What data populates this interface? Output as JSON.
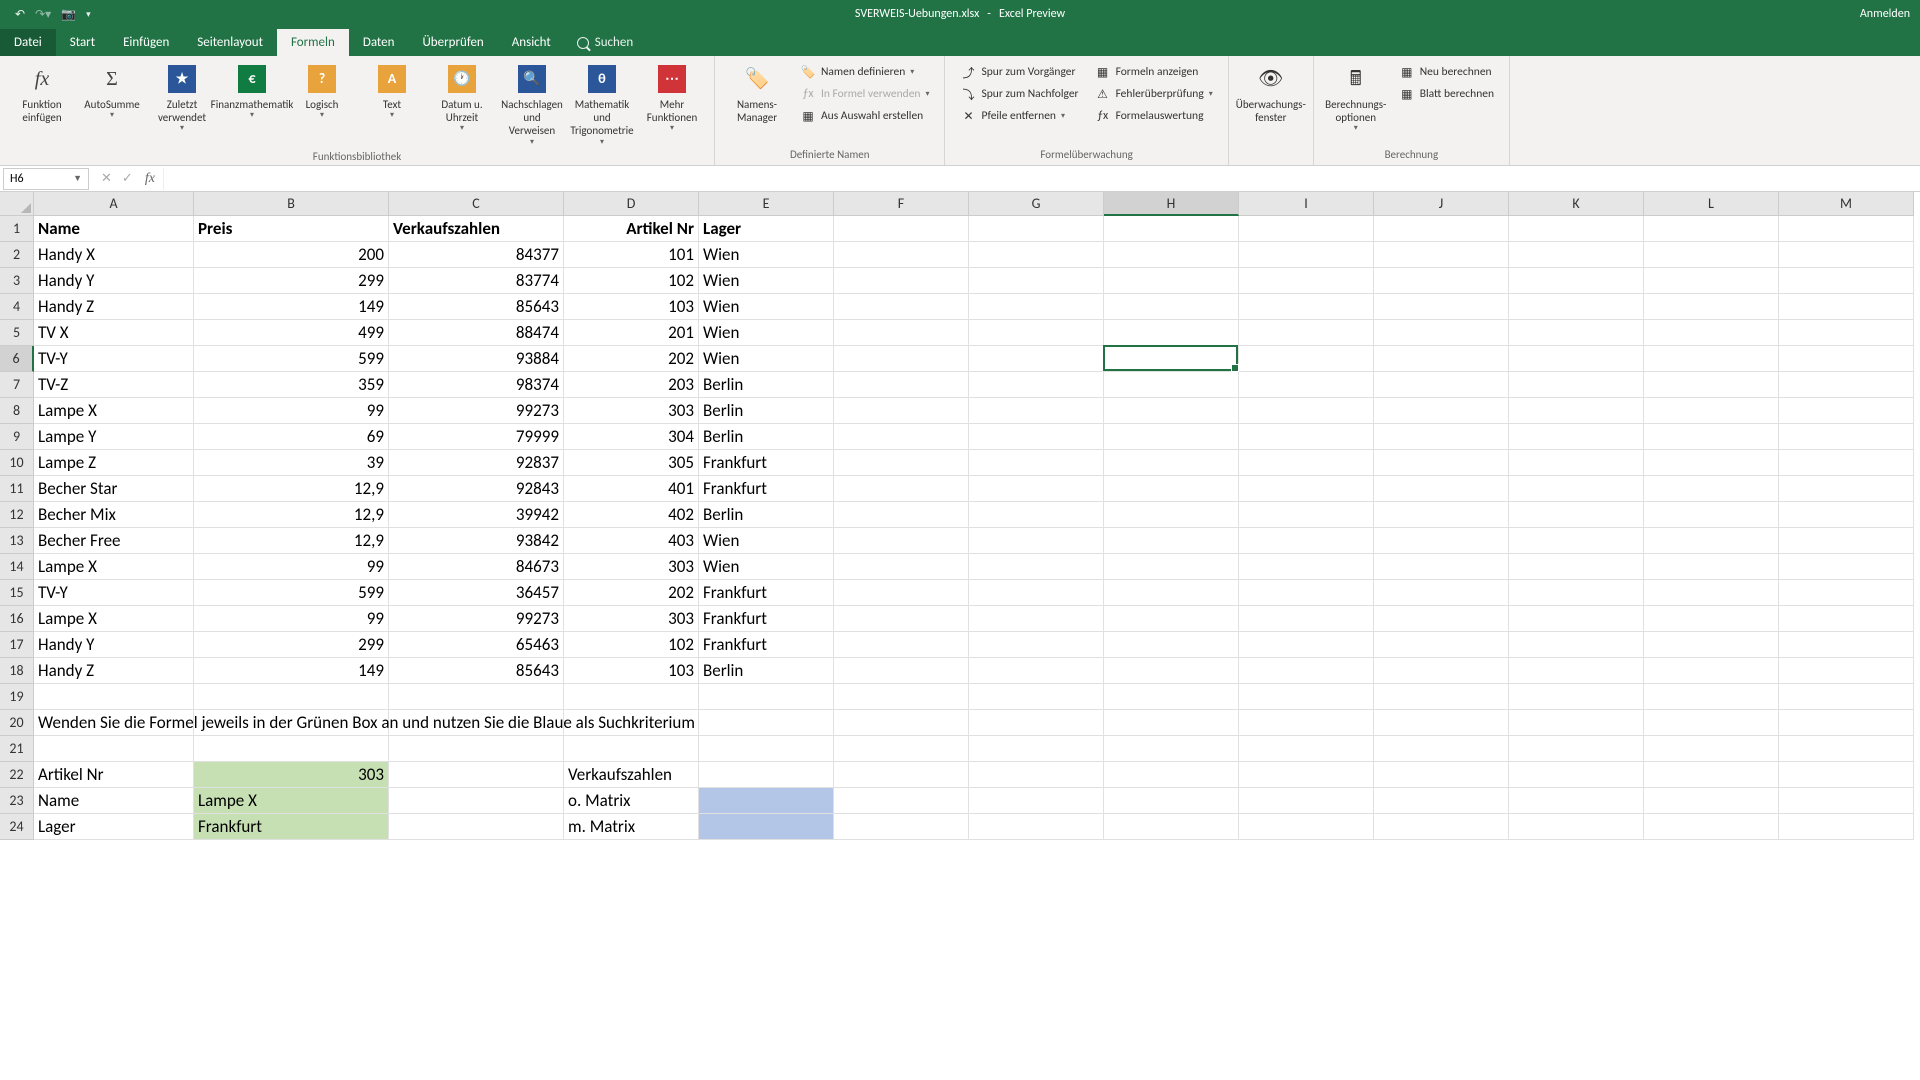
{
  "titlebar": {
    "filename": "SVERWEIS-Uebungen.xlsx",
    "app": "Excel Preview",
    "login": "Anmelden"
  },
  "tabs": {
    "file": "Datei",
    "start": "Start",
    "insert": "Einfügen",
    "layout": "Seitenlayout",
    "formulas": "Formeln",
    "data": "Daten",
    "review": "Überprüfen",
    "view": "Ansicht",
    "search": "Suchen"
  },
  "ribbon": {
    "insert_fn": "Funktion einfügen",
    "autosum": "AutoSumme",
    "recent": "Zuletzt verwendet",
    "financial": "Finanzmathematik",
    "logical": "Logisch",
    "text": "Text",
    "datetime": "Datum u. Uhrzeit",
    "lookup": "Nachschlagen und Verweisen",
    "math": "Mathematik und Trigonometrie",
    "more": "Mehr Funktionen",
    "group_lib": "Funktionsbibliothek",
    "name_mgr": "Namens-Manager",
    "define": "Namen definieren",
    "use_formula": "In Formel verwenden",
    "from_sel": "Aus Auswahl erstellen",
    "group_names": "Definierte Namen",
    "trace_prec": "Spur zum Vorgänger",
    "trace_dep": "Spur zum Nachfolger",
    "remove_arrows": "Pfeile entfernen",
    "show_formulas": "Formeln anzeigen",
    "error_check": "Fehlerüberprüfung",
    "eval_formula": "Formelauswertung",
    "group_audit": "Formelüberwachung",
    "watch": "Überwachungs-fenster",
    "calc_opts": "Berechnungs-optionen",
    "calc_now": "Neu berechnen",
    "calc_sheet": "Blatt berechnen",
    "group_calc": "Berechnung"
  },
  "namebox": "H6",
  "columns": [
    "A",
    "B",
    "C",
    "D",
    "E",
    "F",
    "G",
    "H",
    "I",
    "J",
    "K",
    "L",
    "M"
  ],
  "col_widths": [
    "cA",
    "cB",
    "cC",
    "cD",
    "cE",
    "cF",
    "cG",
    "cH",
    "cI",
    "cJ",
    "cK",
    "cL",
    "cM"
  ],
  "selected_col": "H",
  "selected_row": 6,
  "headers": {
    "A": "Name",
    "B": "Preis",
    "C": "Verkaufszahlen",
    "D": "Artikel Nr",
    "E": "Lager"
  },
  "data_rows": [
    {
      "A": "Handy X",
      "B": "200",
      "C": "84377",
      "D": "101",
      "E": "Wien"
    },
    {
      "A": "Handy Y",
      "B": "299",
      "C": "83774",
      "D": "102",
      "E": "Wien"
    },
    {
      "A": "Handy Z",
      "B": "149",
      "C": "85643",
      "D": "103",
      "E": "Wien"
    },
    {
      "A": "TV X",
      "B": "499",
      "C": "88474",
      "D": "201",
      "E": "Wien"
    },
    {
      "A": "TV-Y",
      "B": "599",
      "C": "93884",
      "D": "202",
      "E": "Wien"
    },
    {
      "A": "TV-Z",
      "B": "359",
      "C": "98374",
      "D": "203",
      "E": "Berlin"
    },
    {
      "A": "Lampe X",
      "B": "99",
      "C": "99273",
      "D": "303",
      "E": "Berlin"
    },
    {
      "A": "Lampe Y",
      "B": "69",
      "C": "79999",
      "D": "304",
      "E": "Berlin"
    },
    {
      "A": "Lampe Z",
      "B": "39",
      "C": "92837",
      "D": "305",
      "E": "Frankfurt"
    },
    {
      "A": "Becher Star",
      "B": "12,9",
      "C": "92843",
      "D": "401",
      "E": "Frankfurt"
    },
    {
      "A": "Becher Mix",
      "B": "12,9",
      "C": "39942",
      "D": "402",
      "E": "Berlin"
    },
    {
      "A": "Becher Free",
      "B": "12,9",
      "C": "93842",
      "D": "403",
      "E": "Wien"
    },
    {
      "A": "Lampe X",
      "B": "99",
      "C": "84673",
      "D": "303",
      "E": "Wien"
    },
    {
      "A": "TV-Y",
      "B": "599",
      "C": "36457",
      "D": "202",
      "E": "Frankfurt"
    },
    {
      "A": "Lampe X",
      "B": "99",
      "C": "99273",
      "D": "303",
      "E": "Frankfurt"
    },
    {
      "A": "Handy Y",
      "B": "299",
      "C": "65463",
      "D": "102",
      "E": "Frankfurt"
    },
    {
      "A": "Handy Z",
      "B": "149",
      "C": "85643",
      "D": "103",
      "E": "Berlin"
    }
  ],
  "row20": "Wenden Sie die Formel jeweils in der Grünen Box an und nutzen Sie die Blaue als Suchkriterium",
  "row22": {
    "A": "Artikel Nr",
    "B": "303",
    "D": "Verkaufszahlen"
  },
  "row23": {
    "A": "Name",
    "B": "Lampe X",
    "D": "o. Matrix"
  },
  "row24": {
    "A": "Lager",
    "B": "Frankfurt",
    "D": "m. Matrix"
  }
}
